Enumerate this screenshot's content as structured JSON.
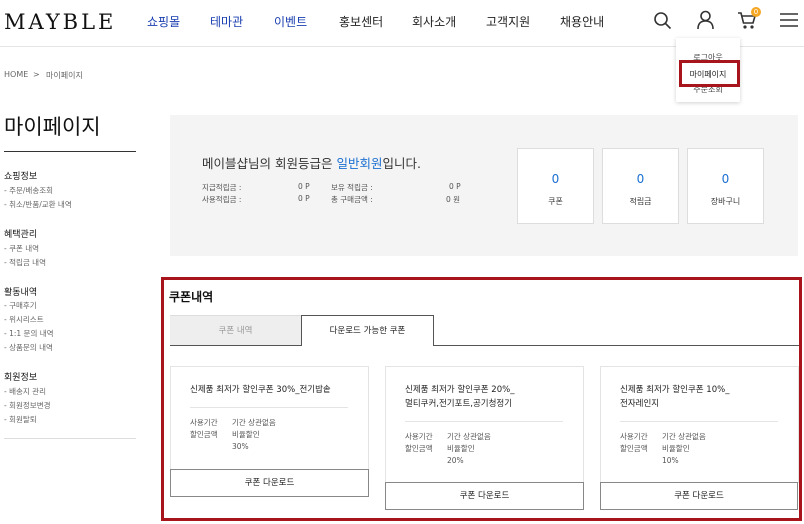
{
  "header": {
    "logo": "MAYBLE",
    "nav": [
      "쇼핑몰",
      "테마관",
      "이벤트",
      "홍보센터",
      "회사소개",
      "고객지원",
      "채용안내"
    ],
    "cart_count": "0"
  },
  "user_menu": {
    "items": [
      "로그아웃",
      "마이페이지",
      "주문조회"
    ]
  },
  "breadcrumb": {
    "home": "HOME",
    "sep": ">",
    "current": "마이페이지"
  },
  "sidebar": {
    "title": "마이페이지",
    "sections": [
      {
        "title": "쇼핑정보",
        "items": [
          "- 주문/배송조회",
          "- 취소/반품/교환 내역"
        ]
      },
      {
        "title": "혜택관리",
        "items": [
          "- 쿠폰 내역",
          "- 적립금 내역"
        ]
      },
      {
        "title": "활동내역",
        "items": [
          "- 구매후기",
          "- 위시리스트",
          "- 1:1 문의 내역",
          "- 상품문의 내역"
        ]
      },
      {
        "title": "회원정보",
        "items": [
          "- 배송지 관리",
          "- 회원정보변경",
          "- 회원탈퇴"
        ]
      }
    ]
  },
  "grade": {
    "prefix": "메이블샵님의 회원등급은 ",
    "level": "일반회원",
    "suffix": "입니다.",
    "points": [
      {
        "label": "지급적립금 :",
        "value": "0 P"
      },
      {
        "label": "사용적립금 :",
        "value": "0 P"
      },
      {
        "label": "보유 적립금 :",
        "value": "0 P"
      },
      {
        "label": "총 구매금액 :",
        "value": "0 원"
      }
    ],
    "stats": [
      {
        "count": "0",
        "label": "쿠폰"
      },
      {
        "count": "0",
        "label": "적립금"
      },
      {
        "count": "0",
        "label": "장바구니"
      }
    ]
  },
  "coupons": {
    "title": "쿠폰내역",
    "tabs": [
      "쿠폰 내역",
      "다운로드 가능한 쿠폰"
    ],
    "usage_label": "사용기간",
    "discount_label": "할인금액",
    "download_label": "쿠폰 다운로드",
    "items": [
      {
        "name_lines": [
          "신제품 최저가 할인쿠폰 30%_전기밥솥"
        ],
        "period": "기간 상관없음",
        "type": "비율할인",
        "rate": "30%"
      },
      {
        "name_lines": [
          "신제품 최저가 할인쿠폰 20%_",
          "멀티쿠커,전기포트,공기청정기"
        ],
        "period": "기간 상관없음",
        "type": "비율할인",
        "rate": "20%"
      },
      {
        "name_lines": [
          "신제품 최저가 할인쿠폰 10%_",
          "전자레인지"
        ],
        "period": "기간 상관없음",
        "type": "비율할인",
        "rate": "10%"
      }
    ]
  }
}
